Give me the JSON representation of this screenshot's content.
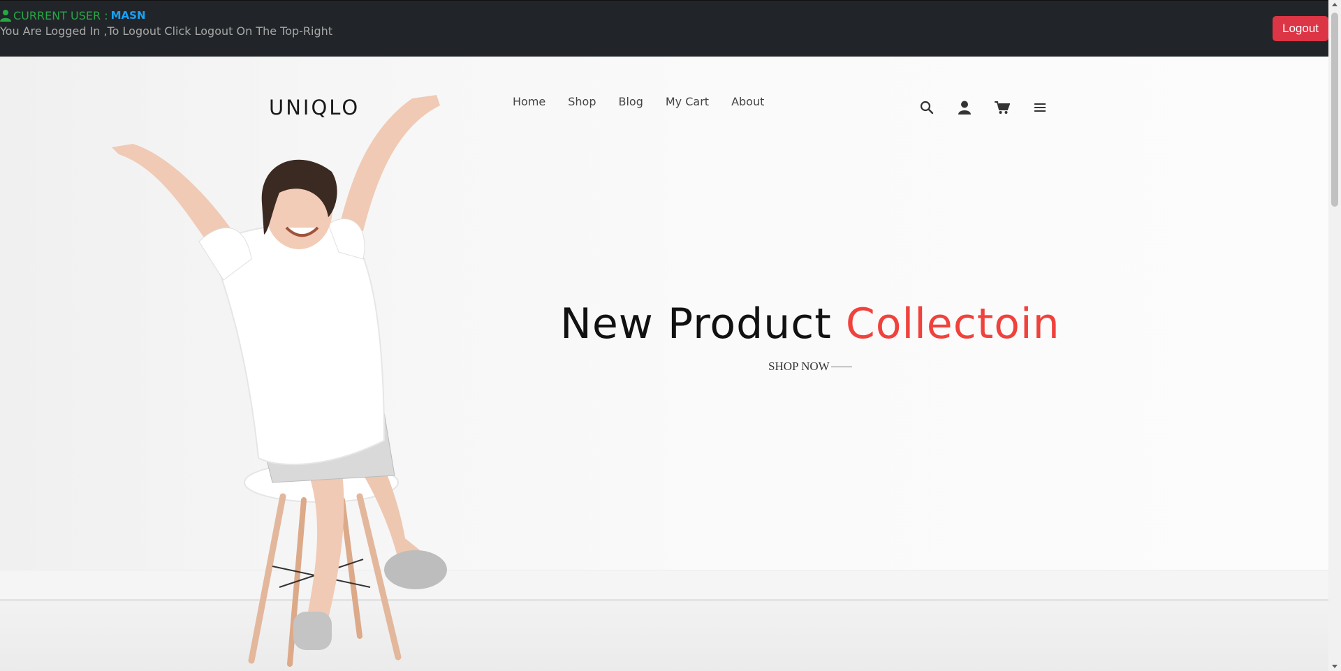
{
  "user_bar": {
    "label": "CURRENT USER :",
    "username": "MASN",
    "message": "You Are Logged In ,To Logout Click Logout On The Top-Right",
    "logout_label": "Logout",
    "icon": "user-icon"
  },
  "header": {
    "brand": "UNIQLO",
    "nav": [
      "Home",
      "Shop",
      "Blog",
      "My Cart",
      "About"
    ],
    "icons": [
      "search-icon",
      "account-icon",
      "cart-icon",
      "menu-icon"
    ]
  },
  "hero": {
    "title_main": "New Product",
    "title_accent": "Collectoin",
    "cta": "SHOP NOW"
  },
  "colors": {
    "topbar_bg": "#212529",
    "logout_bg": "#dc3545",
    "accent_red": "#f0423c",
    "user_label_green": "#28a745",
    "username_blue": "#17a2f8"
  }
}
